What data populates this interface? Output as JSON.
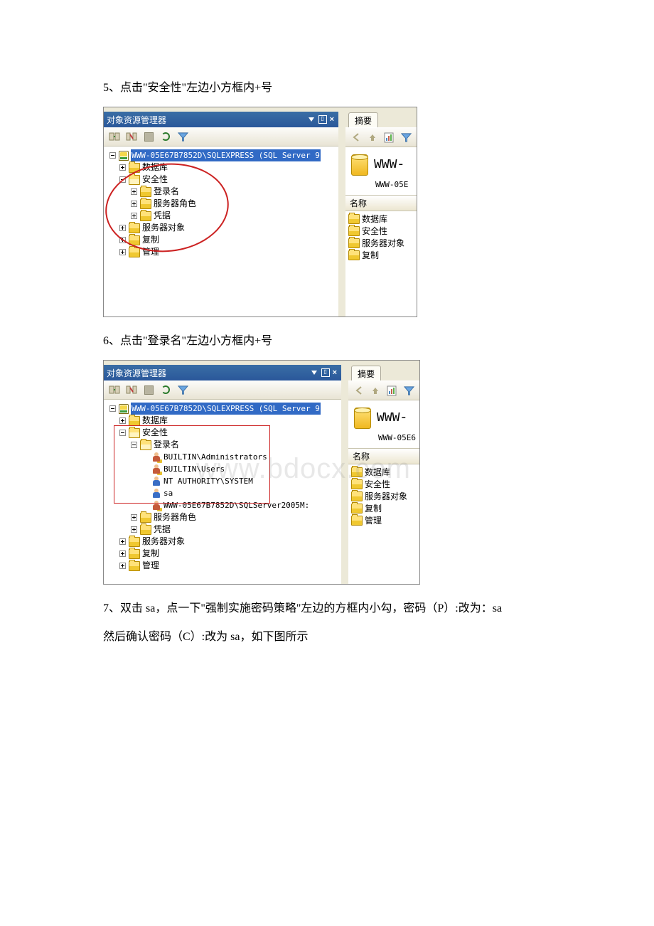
{
  "steps": {
    "s5": "5、点击\"安全性\"左边小方框内+号",
    "s6": "6、点击\"登录名\"左边小方框内+号",
    "s7a": "7、双击 sa，点一下\"强制实施密码策略\"左边的方框内小勾，密码（P）:改为：sa",
    "s7b": "然后确认密码（C）:改为 sa，如下图所示"
  },
  "panel": {
    "title": "对象资源管理器",
    "rootServer": "WWW-05E67B7852D\\SQLEXPRESS  (SQL Server 9",
    "rootServer2": "WWW-05E67B7852D\\SQLEXPRESS  (SQL Server 9"
  },
  "tree1": {
    "n_db": "数据库",
    "n_sec": "安全性",
    "n_login": "登录名",
    "n_role": "服务器角色",
    "n_cred": "凭据",
    "n_srvobj": "服务器对象",
    "n_repl": "复制",
    "n_mgmt": "管理"
  },
  "tree2": {
    "n_db": "数据库",
    "n_sec": "安全性",
    "n_login": "登录名",
    "l_admin": "BUILTIN\\Administrators",
    "l_users": "BUILTIN\\Users",
    "l_nt": "NT AUTHORITY\\SYSTEM",
    "l_sa": "sa",
    "l_ms": "WWW-05E67B7852D\\SQLServer2005M:",
    "n_role": "服务器角色",
    "n_cred": "凭据",
    "n_srvobj": "服务器对象",
    "n_repl": "复制",
    "n_mgmt": "管理"
  },
  "right": {
    "tab": "摘要",
    "header": "WWW-",
    "header2": "WWW-",
    "sub": "WWW-05E",
    "sub2": "WWW-05E6",
    "colName": "名称",
    "items1": [
      "数据库",
      "安全性",
      "服务器对象",
      "复制"
    ],
    "items2": [
      "数据库",
      "安全性",
      "服务器对象",
      "复制",
      "管理"
    ]
  },
  "watermark": "www.bdocx.com"
}
